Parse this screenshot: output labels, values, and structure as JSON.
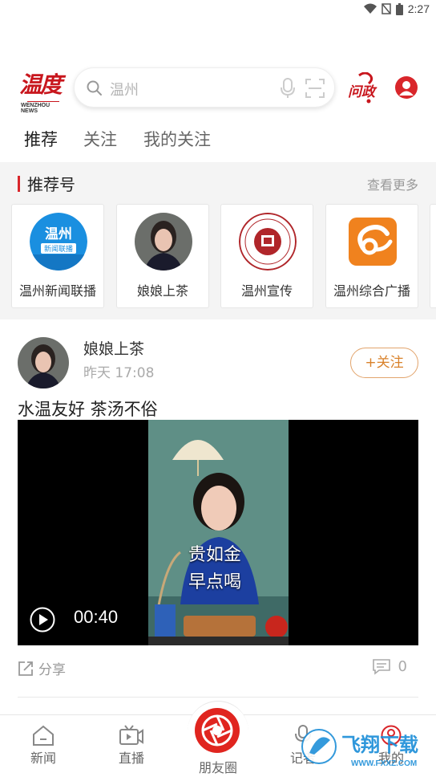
{
  "status_bar": {
    "time": "2:27"
  },
  "header": {
    "logo_text": "温度",
    "logo_sub": "WENZHOU NEWS",
    "search_placeholder": "温州",
    "wenzheng_label": "问政"
  },
  "tabs": [
    {
      "label": "推荐",
      "active": true
    },
    {
      "label": "关注",
      "active": false
    },
    {
      "label": "我的关注",
      "active": false
    }
  ],
  "recommend": {
    "title": "推荐号",
    "more": "查看更多",
    "items": [
      {
        "name": "温州新闻联播",
        "avatar_text": "温州",
        "avatar_sub": "新闻联播"
      },
      {
        "name": "娘娘上茶"
      },
      {
        "name": "温州宣传"
      },
      {
        "name": "温州综合广播"
      }
    ]
  },
  "post": {
    "author": "娘娘上茶",
    "time": "昨天  17:08",
    "follow_label": "+关注",
    "title": "水温友好  茶汤不俗",
    "video_caption_line1": "贵如金",
    "video_caption_line2": "早点喝",
    "duration": "00:40",
    "share_label": "分享",
    "comment_count": "0"
  },
  "bottom_nav": [
    {
      "label": "新闻"
    },
    {
      "label": "直播"
    },
    {
      "label": "朋友圈"
    },
    {
      "label": "记者"
    },
    {
      "label": "我的"
    }
  ],
  "watermark": {
    "text": "飞翔下载",
    "sub": "WWW.FXXZ.COM"
  },
  "colors": {
    "brand_red": "#d9262b",
    "follow_orange": "#d9822b",
    "rec_bg": "#f4f4f4"
  }
}
